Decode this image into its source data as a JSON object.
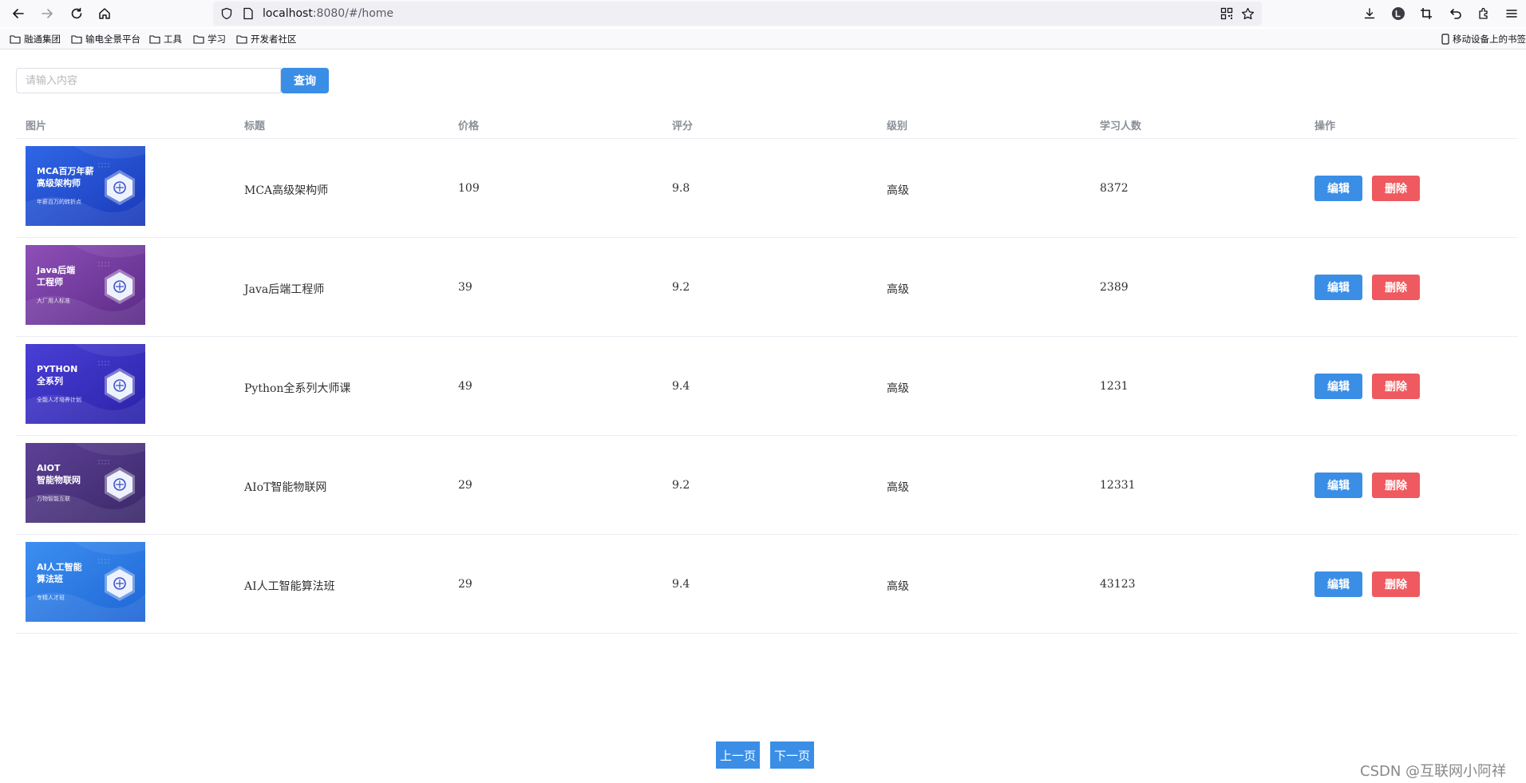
{
  "browser": {
    "url_host": "localhost",
    "url_rest": ":8080/#/home",
    "bookmarks": [
      "融通集团",
      "输电全景平台",
      "工具",
      "学习",
      "开发者社区"
    ],
    "mobile_bookmarks": "移动设备上的书签"
  },
  "search": {
    "placeholder": "请输入内容",
    "button_label": "查询"
  },
  "table": {
    "headers": {
      "image": "图片",
      "title": "标题",
      "price": "价格",
      "rating": "评分",
      "level": "级别",
      "learners": "学习人数",
      "actions": "操作"
    },
    "edit_label": "编辑",
    "delete_label": "删除",
    "rows": [
      {
        "thumb_title": "MCA百万年薪\n高级架构师",
        "thumb_sub": "年薪百万的转折点",
        "thumb_icon": "layers-icon",
        "thumb_color_a": "#2f67e6",
        "thumb_color_b": "#1a39b8",
        "title": "MCA高级架构师",
        "price": "109",
        "rating": "9.8",
        "level": "高级",
        "learners": "8372"
      },
      {
        "thumb_title": "Java后端\n工程师",
        "thumb_sub": "大厂用人标准",
        "thumb_icon": "java-icon",
        "thumb_color_a": "#8e4fb8",
        "thumb_color_b": "#5a2a86",
        "title": "Java后端工程师",
        "price": "39",
        "rating": "9.2",
        "level": "高级",
        "learners": "2389"
      },
      {
        "thumb_title": "PYTHON\n全系列",
        "thumb_sub": "全能人才培养计划",
        "thumb_icon": "python-icon",
        "thumb_color_a": "#4a3fd6",
        "thumb_color_b": "#2a22a8",
        "title": "Python全系列大师课",
        "price": "49",
        "rating": "9.4",
        "level": "高级",
        "learners": "1231"
      },
      {
        "thumb_title": "AIOT\n智能物联网",
        "thumb_sub": "万物智能互联",
        "thumb_icon": "iot-icon",
        "thumb_color_a": "#5e4096",
        "thumb_color_b": "#3a2868",
        "title": "AIoT智能物联网",
        "price": "29",
        "rating": "9.2",
        "level": "高级",
        "learners": "12331"
      },
      {
        "thumb_title": "AI人工智能\n算法班",
        "thumb_sub": "专精人才班",
        "thumb_icon": "ai-icon",
        "thumb_color_a": "#3c8ff0",
        "thumb_color_b": "#1f66d6",
        "title": "AI人工智能算法班",
        "price": "29",
        "rating": "9.4",
        "level": "高级",
        "learners": "43123"
      }
    ]
  },
  "pagination": {
    "prev_label": "上一页",
    "next_label": "下一页"
  },
  "watermark": "CSDN @互联网小阿祥",
  "colors": {
    "primary": "#3a8ee6",
    "danger": "#ee5a5f"
  }
}
